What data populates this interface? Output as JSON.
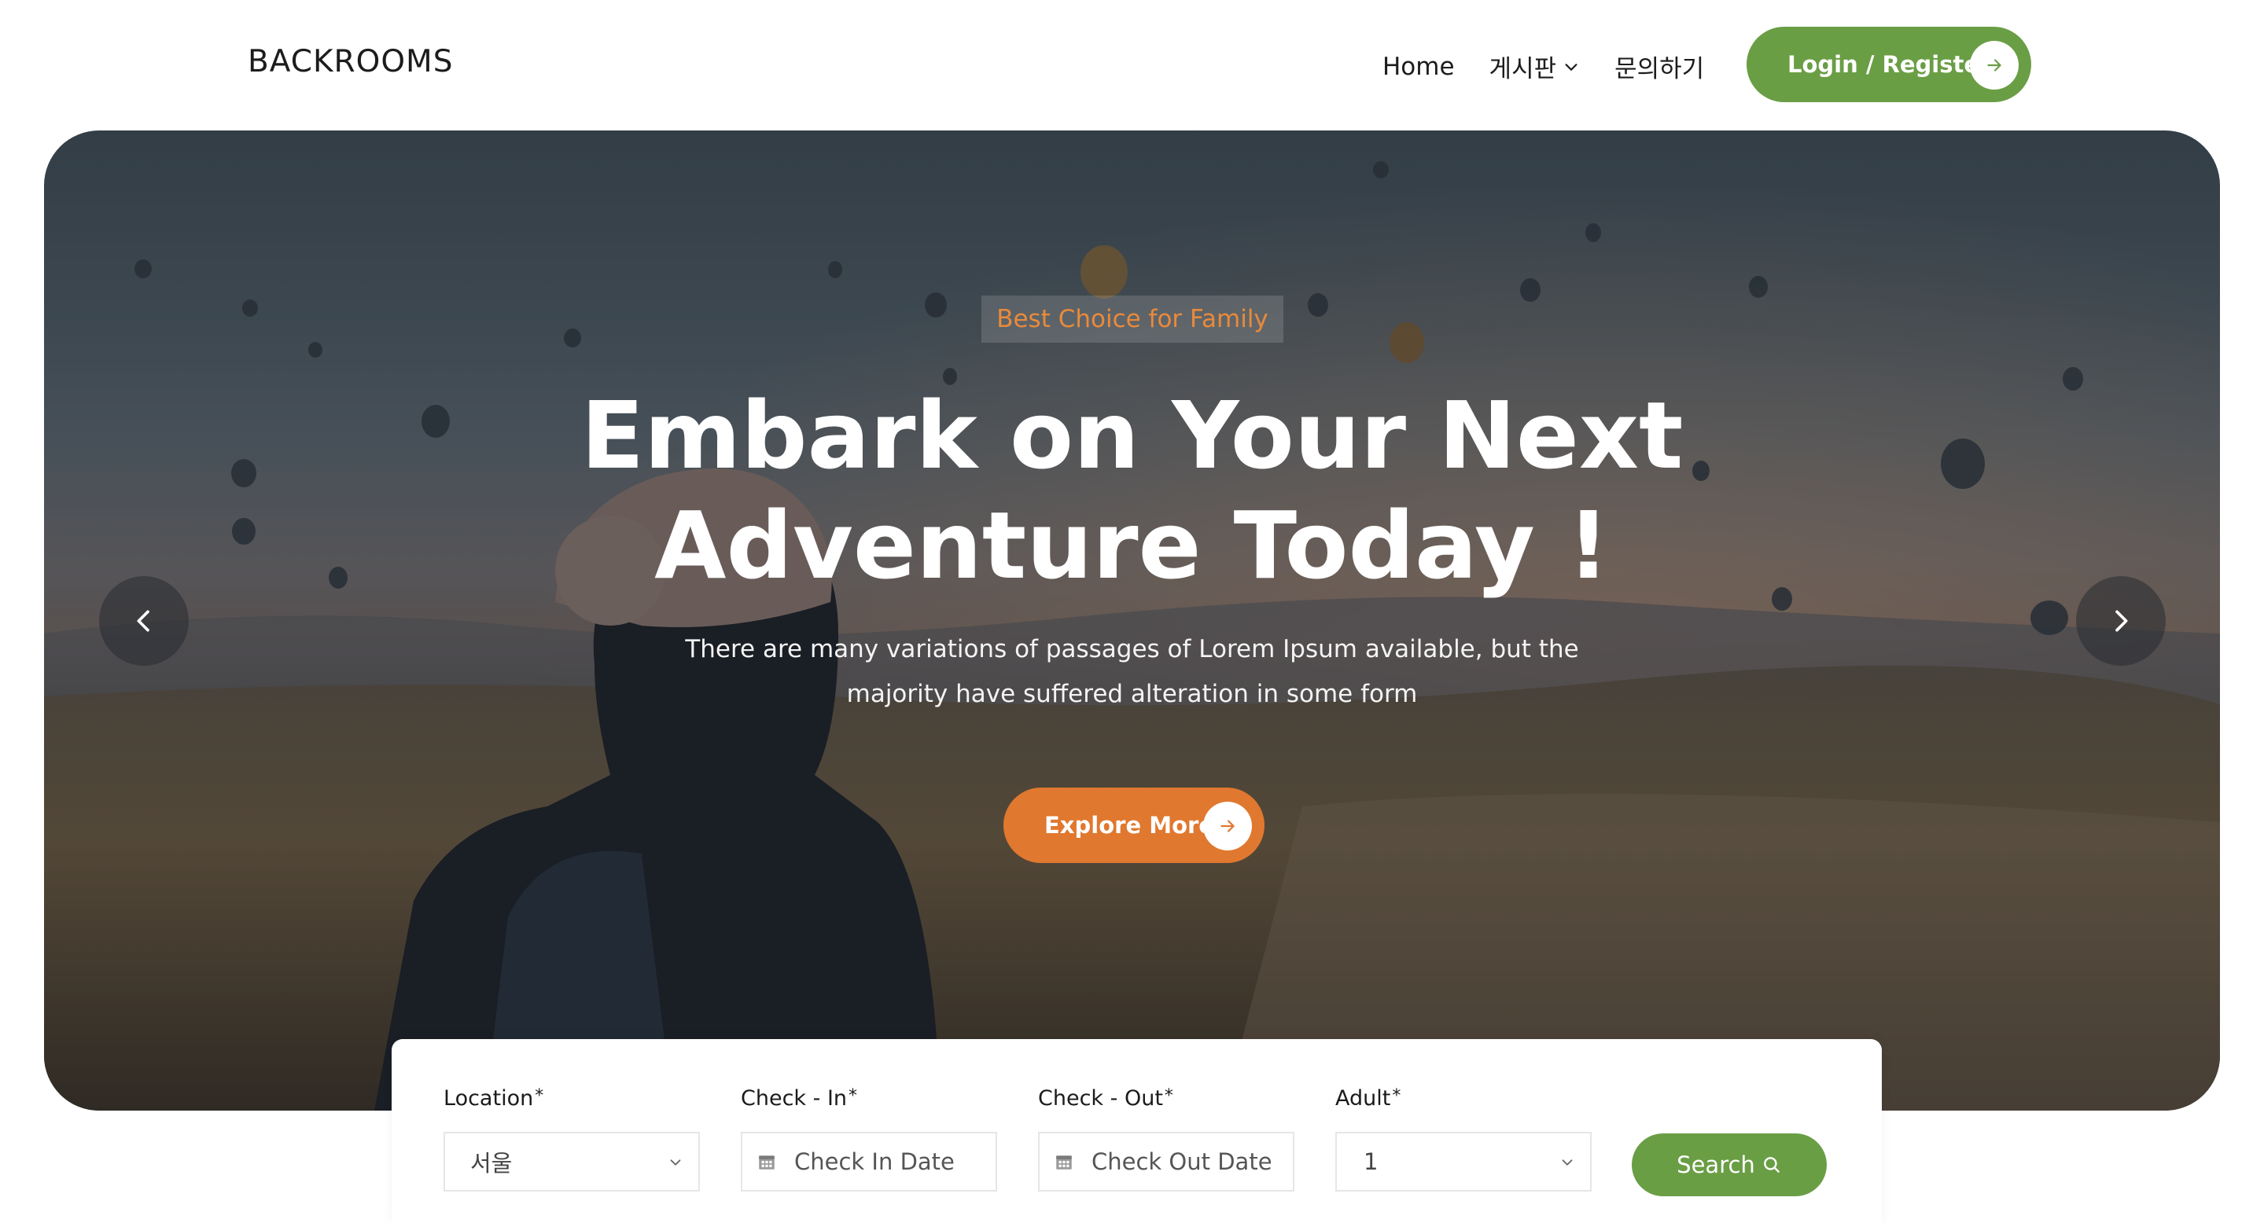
{
  "header": {
    "logo": "BACKROOMS",
    "nav": [
      {
        "label": "Home"
      },
      {
        "label": "게시판"
      },
      {
        "label": "문의하기"
      }
    ],
    "login_label": "Login / Register"
  },
  "hero": {
    "badge": "Best Choice for Family",
    "title_line1": "Embark on Your Next",
    "title_line2": "Adventure Today !",
    "subtitle_line1": "There are many variations of passages of Lorem Ipsum available, but the",
    "subtitle_line2": "majority have suffered alteration in some form",
    "cta_label": "Explore More"
  },
  "search": {
    "location_label": "Location",
    "location_value": "서울",
    "checkin_label": "Check - In",
    "checkin_placeholder": "Check In Date",
    "checkout_label": "Check - Out",
    "checkout_placeholder": "Check Out Date",
    "adult_label": "Adult",
    "adult_value": "1",
    "required_mark": "*",
    "search_label": "Search"
  },
  "colors": {
    "brand_green": "#6a9e45",
    "accent_orange": "#e0782f",
    "badge_text": "#e98a3b"
  },
  "icons": [
    "chevron-down-icon",
    "arrow-right-icon",
    "chevron-left-icon",
    "chevron-right-icon",
    "calendar-icon",
    "search-icon"
  ]
}
